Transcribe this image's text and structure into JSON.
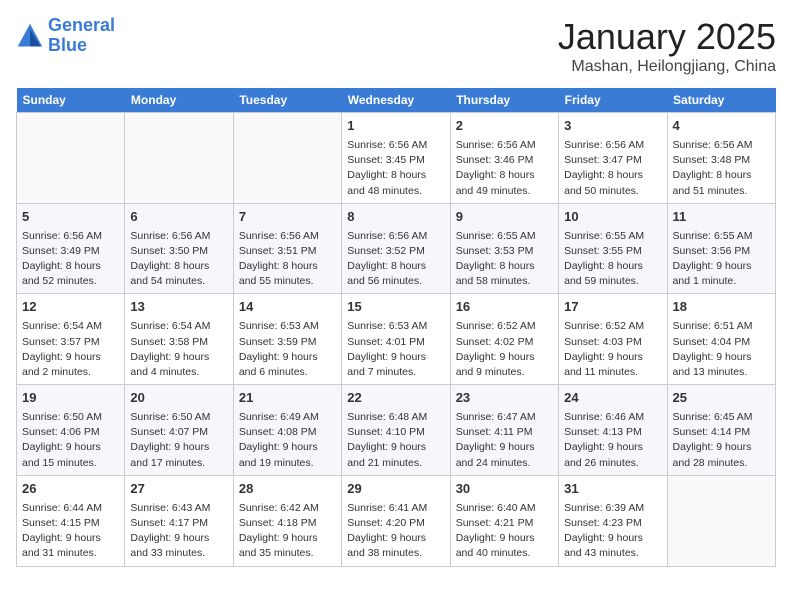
{
  "header": {
    "logo_line1": "General",
    "logo_line2": "Blue",
    "month": "January 2025",
    "location": "Mashan, Heilongjiang, China"
  },
  "weekdays": [
    "Sunday",
    "Monday",
    "Tuesday",
    "Wednesday",
    "Thursday",
    "Friday",
    "Saturday"
  ],
  "weeks": [
    [
      {
        "day": "",
        "info": ""
      },
      {
        "day": "",
        "info": ""
      },
      {
        "day": "",
        "info": ""
      },
      {
        "day": "1",
        "info": "Sunrise: 6:56 AM\nSunset: 3:45 PM\nDaylight: 8 hours\nand 48 minutes."
      },
      {
        "day": "2",
        "info": "Sunrise: 6:56 AM\nSunset: 3:46 PM\nDaylight: 8 hours\nand 49 minutes."
      },
      {
        "day": "3",
        "info": "Sunrise: 6:56 AM\nSunset: 3:47 PM\nDaylight: 8 hours\nand 50 minutes."
      },
      {
        "day": "4",
        "info": "Sunrise: 6:56 AM\nSunset: 3:48 PM\nDaylight: 8 hours\nand 51 minutes."
      }
    ],
    [
      {
        "day": "5",
        "info": "Sunrise: 6:56 AM\nSunset: 3:49 PM\nDaylight: 8 hours\nand 52 minutes."
      },
      {
        "day": "6",
        "info": "Sunrise: 6:56 AM\nSunset: 3:50 PM\nDaylight: 8 hours\nand 54 minutes."
      },
      {
        "day": "7",
        "info": "Sunrise: 6:56 AM\nSunset: 3:51 PM\nDaylight: 8 hours\nand 55 minutes."
      },
      {
        "day": "8",
        "info": "Sunrise: 6:56 AM\nSunset: 3:52 PM\nDaylight: 8 hours\nand 56 minutes."
      },
      {
        "day": "9",
        "info": "Sunrise: 6:55 AM\nSunset: 3:53 PM\nDaylight: 8 hours\nand 58 minutes."
      },
      {
        "day": "10",
        "info": "Sunrise: 6:55 AM\nSunset: 3:55 PM\nDaylight: 8 hours\nand 59 minutes."
      },
      {
        "day": "11",
        "info": "Sunrise: 6:55 AM\nSunset: 3:56 PM\nDaylight: 9 hours\nand 1 minute."
      }
    ],
    [
      {
        "day": "12",
        "info": "Sunrise: 6:54 AM\nSunset: 3:57 PM\nDaylight: 9 hours\nand 2 minutes."
      },
      {
        "day": "13",
        "info": "Sunrise: 6:54 AM\nSunset: 3:58 PM\nDaylight: 9 hours\nand 4 minutes."
      },
      {
        "day": "14",
        "info": "Sunrise: 6:53 AM\nSunset: 3:59 PM\nDaylight: 9 hours\nand 6 minutes."
      },
      {
        "day": "15",
        "info": "Sunrise: 6:53 AM\nSunset: 4:01 PM\nDaylight: 9 hours\nand 7 minutes."
      },
      {
        "day": "16",
        "info": "Sunrise: 6:52 AM\nSunset: 4:02 PM\nDaylight: 9 hours\nand 9 minutes."
      },
      {
        "day": "17",
        "info": "Sunrise: 6:52 AM\nSunset: 4:03 PM\nDaylight: 9 hours\nand 11 minutes."
      },
      {
        "day": "18",
        "info": "Sunrise: 6:51 AM\nSunset: 4:04 PM\nDaylight: 9 hours\nand 13 minutes."
      }
    ],
    [
      {
        "day": "19",
        "info": "Sunrise: 6:50 AM\nSunset: 4:06 PM\nDaylight: 9 hours\nand 15 minutes."
      },
      {
        "day": "20",
        "info": "Sunrise: 6:50 AM\nSunset: 4:07 PM\nDaylight: 9 hours\nand 17 minutes."
      },
      {
        "day": "21",
        "info": "Sunrise: 6:49 AM\nSunset: 4:08 PM\nDaylight: 9 hours\nand 19 minutes."
      },
      {
        "day": "22",
        "info": "Sunrise: 6:48 AM\nSunset: 4:10 PM\nDaylight: 9 hours\nand 21 minutes."
      },
      {
        "day": "23",
        "info": "Sunrise: 6:47 AM\nSunset: 4:11 PM\nDaylight: 9 hours\nand 24 minutes."
      },
      {
        "day": "24",
        "info": "Sunrise: 6:46 AM\nSunset: 4:13 PM\nDaylight: 9 hours\nand 26 minutes."
      },
      {
        "day": "25",
        "info": "Sunrise: 6:45 AM\nSunset: 4:14 PM\nDaylight: 9 hours\nand 28 minutes."
      }
    ],
    [
      {
        "day": "26",
        "info": "Sunrise: 6:44 AM\nSunset: 4:15 PM\nDaylight: 9 hours\nand 31 minutes."
      },
      {
        "day": "27",
        "info": "Sunrise: 6:43 AM\nSunset: 4:17 PM\nDaylight: 9 hours\nand 33 minutes."
      },
      {
        "day": "28",
        "info": "Sunrise: 6:42 AM\nSunset: 4:18 PM\nDaylight: 9 hours\nand 35 minutes."
      },
      {
        "day": "29",
        "info": "Sunrise: 6:41 AM\nSunset: 4:20 PM\nDaylight: 9 hours\nand 38 minutes."
      },
      {
        "day": "30",
        "info": "Sunrise: 6:40 AM\nSunset: 4:21 PM\nDaylight: 9 hours\nand 40 minutes."
      },
      {
        "day": "31",
        "info": "Sunrise: 6:39 AM\nSunset: 4:23 PM\nDaylight: 9 hours\nand 43 minutes."
      },
      {
        "day": "",
        "info": ""
      }
    ]
  ]
}
